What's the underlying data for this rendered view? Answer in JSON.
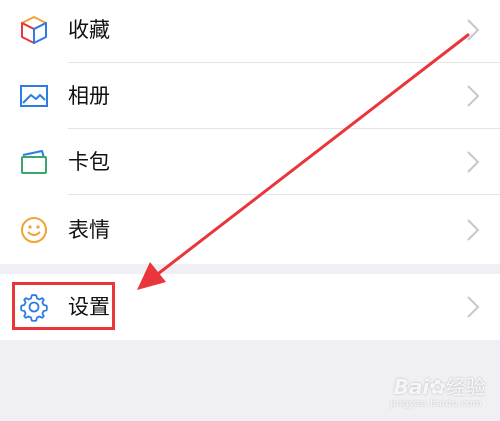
{
  "menu": {
    "items": [
      {
        "label": "收藏",
        "icon": "favorites-cube-icon"
      },
      {
        "label": "相册",
        "icon": "photo-album-icon"
      },
      {
        "label": "卡包",
        "icon": "card-wallet-icon"
      },
      {
        "label": "表情",
        "icon": "smiley-face-icon"
      }
    ],
    "settings": {
      "label": "设置",
      "icon": "gear-icon"
    }
  },
  "annotation": {
    "highlight_color": "#e8363c",
    "arrow_color": "#e8363c"
  },
  "watermark": {
    "brand": "Bai",
    "sub": "经验",
    "url": "jingyan.baidu.com"
  },
  "colors": {
    "icon_blue": "#2d7be5",
    "icon_orange": "#f0a336",
    "chevron": "#c7c7cc"
  }
}
